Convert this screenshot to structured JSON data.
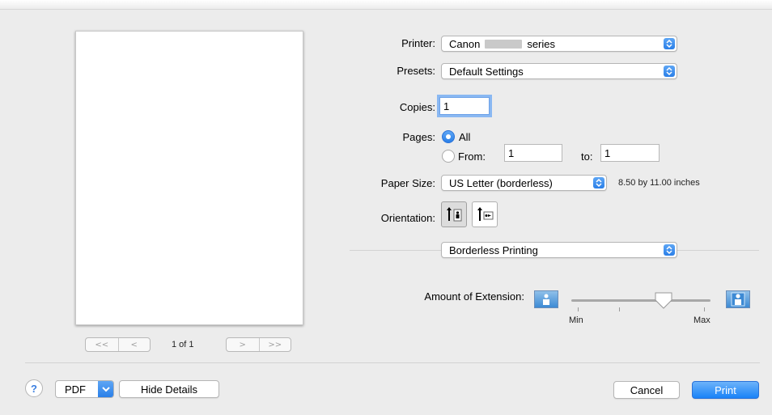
{
  "printer": {
    "label": "Printer:",
    "value_prefix": "Canon",
    "value_suffix": "series"
  },
  "presets": {
    "label": "Presets:",
    "value": "Default Settings"
  },
  "copies": {
    "label": "Copies:",
    "value": "1"
  },
  "pages": {
    "label": "Pages:",
    "all_label": "All",
    "from_label": "From:",
    "from_value": "1",
    "to_label": "to:",
    "to_value": "1",
    "selected": "All"
  },
  "paper_size": {
    "label": "Paper Size:",
    "value": "US Letter (borderless)",
    "dimensions": "8.50 by 11.00 inches"
  },
  "orientation": {
    "label": "Orientation:",
    "selected": "portrait"
  },
  "section_popup": {
    "value": "Borderless Printing"
  },
  "extension": {
    "label": "Amount of Extension:",
    "min_label": "Min",
    "max_label": "Max",
    "level_fraction": 0.67
  },
  "preview": {
    "page_count": "1 of 1",
    "first": "<<",
    "prev": "<",
    "next": ">",
    "last": ">>"
  },
  "bottom": {
    "help": "?",
    "pdf": "PDF",
    "hide_details": "Hide Details",
    "cancel": "Cancel",
    "print": "Print"
  },
  "colors": {
    "accent": "#2a7fe8",
    "background": "#ececec"
  }
}
